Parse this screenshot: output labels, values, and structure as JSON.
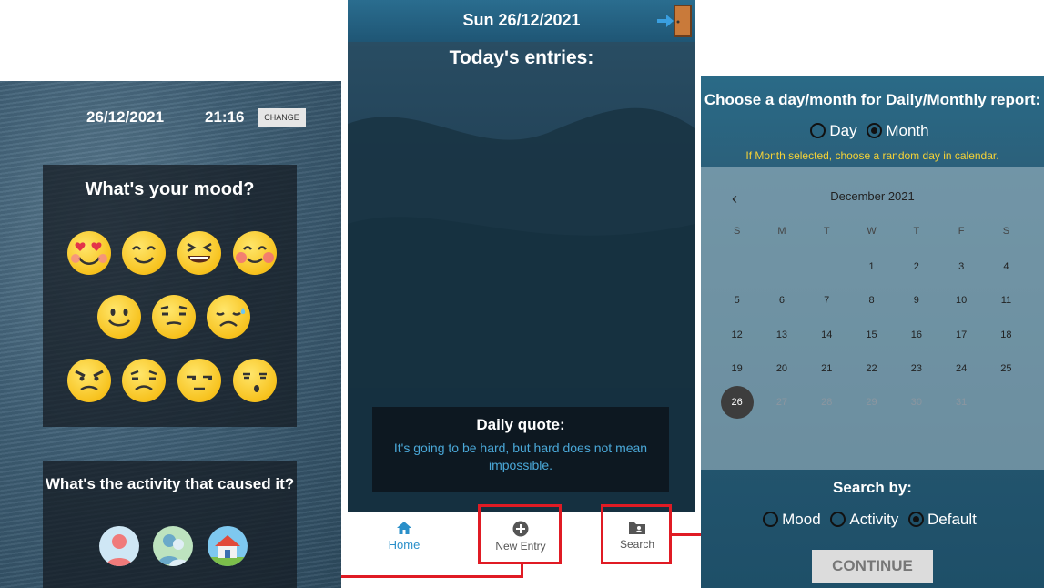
{
  "panel1": {
    "date": "26/12/2021",
    "time": "21:16",
    "change_label": "CHANGE",
    "mood_title": "What's your mood?",
    "activity_title": "What's the activity that caused it?",
    "moods": [
      "heart-eyes-emoji",
      "happy-emoji",
      "laughing-emoji",
      "blushing-emoji",
      "smile-emoji",
      "doubtful-emoji",
      "sad-sweat-emoji",
      "angry-emoji",
      "frowning-emoji",
      "unamused-emoji",
      "whistling-emoji"
    ],
    "activities": [
      "person-icon",
      "people-icon",
      "home-icon"
    ]
  },
  "panel2": {
    "date": "Sun 26/12/2021",
    "entries_title": "Today's entries:",
    "quote_title": "Daily quote:",
    "quote_text": "It's going to be hard, but hard does not mean impossible.",
    "nav": {
      "home": "Home",
      "new_entry": "New Entry",
      "search": "Search"
    },
    "accent_color": "#2a8fc9"
  },
  "panel3": {
    "title": "Choose a day/month for Daily/Monthly report:",
    "day_label": "Day",
    "month_label": "Month",
    "hint": "If Month selected, choose a random day in calendar.",
    "calendar": {
      "month": "December 2021",
      "weekdays": [
        "S",
        "M",
        "T",
        "W",
        "T",
        "F",
        "S"
      ],
      "rows": [
        [
          "",
          "",
          "",
          "1",
          "2",
          "3",
          "4"
        ],
        [
          "5",
          "6",
          "7",
          "8",
          "9",
          "10",
          "11"
        ],
        [
          "12",
          "13",
          "14",
          "15",
          "16",
          "17",
          "18"
        ],
        [
          "19",
          "20",
          "21",
          "22",
          "23",
          "24",
          "25"
        ],
        [
          "26",
          "27",
          "28",
          "29",
          "30",
          "31",
          ""
        ]
      ],
      "selected": "26"
    },
    "search_title": "Search by:",
    "search_options": {
      "mood": "Mood",
      "activity": "Activity",
      "default": "Default"
    },
    "continue_label": "CONTINUE"
  },
  "highlight_color": "#e01b24"
}
